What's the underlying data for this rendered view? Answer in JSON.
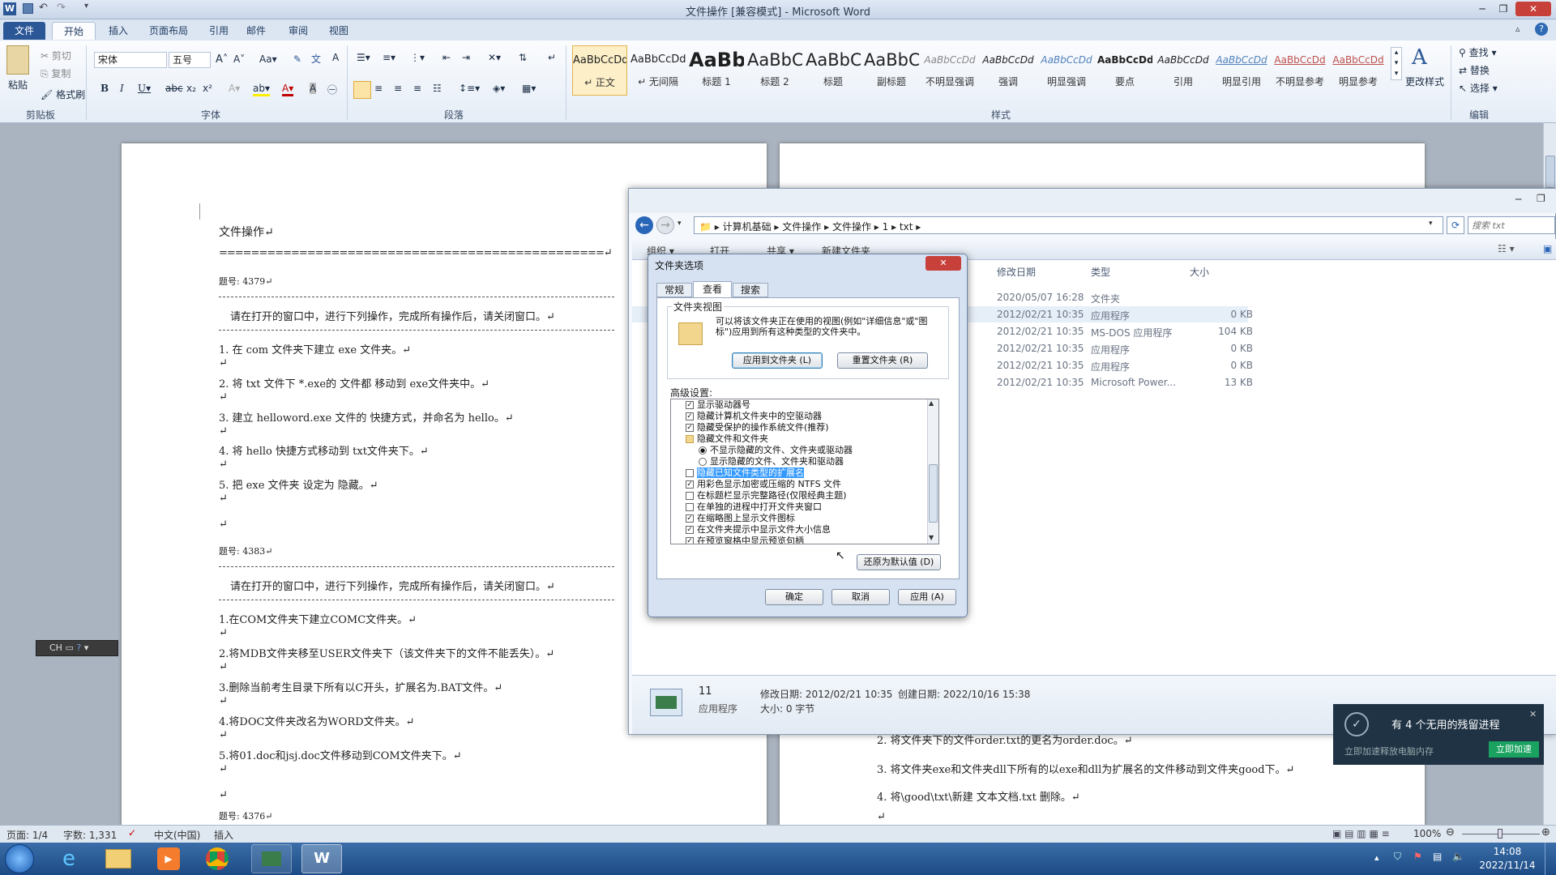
{
  "window": {
    "title": "文件操作 [兼容模式] - Microsoft Word"
  },
  "tabs": [
    "文件",
    "开始",
    "插入",
    "页面布局",
    "引用",
    "邮件",
    "审阅",
    "视图"
  ],
  "ribbon": {
    "clipboard": {
      "paste": "粘贴",
      "cut": "剪切",
      "copy": "复制",
      "format_painter": "格式刷",
      "label": "剪贴板"
    },
    "font": {
      "name": "宋体",
      "size": "五号",
      "label": "字体"
    },
    "paragraph": {
      "label": "段落"
    },
    "styles": {
      "label": "样式",
      "items": [
        {
          "preview": "AaBbCcDd",
          "name": "↵ 正文"
        },
        {
          "preview": "AaBbCcDd",
          "name": "↵ 无间隔"
        },
        {
          "preview": "AaBb",
          "name": "标题 1"
        },
        {
          "preview": "AaBbC",
          "name": "标题 2"
        },
        {
          "preview": "AaBbC",
          "name": "标题"
        },
        {
          "preview": "AaBbC",
          "name": "副标题"
        },
        {
          "preview": "AaBbCcDd",
          "name": "不明显强调"
        },
        {
          "preview": "AaBbCcDd",
          "name": "强调"
        },
        {
          "preview": "AaBbCcDd",
          "name": "明显强调"
        },
        {
          "preview": "AaBbCcDd",
          "name": "要点"
        },
        {
          "preview": "AaBbCcDd",
          "name": "引用"
        },
        {
          "preview": "AaBbCcDd",
          "name": "明显引用"
        },
        {
          "preview": "AaBbCcDd",
          "name": "不明显参考"
        },
        {
          "preview": "AaBbCcDd",
          "name": "明显参考"
        }
      ],
      "change_styles": "更改样式"
    },
    "editing": {
      "find": "查找",
      "replace": "替换",
      "select": "选择",
      "label": "编辑"
    }
  },
  "doc_left": {
    "heading": "文件操作↵",
    "equals": "================================================↵",
    "q1_id": "题号: 4379↵",
    "instr": "请在打开的窗口中，进行下列操作，完成所有操作后，请关闭窗口。↵",
    "q1_items": [
      "1. 在 com 文件夹下建立 exe 文件夹。↵",
      "2. 将 txt 文件下 *.exe的 文件都 移动到 exe文件夹中。↵",
      "3. 建立 helloword.exe 文件的 快捷方式，并命名为 hello。↵",
      "4. 将 hello 快捷方式移动到 txt文件夹下。↵",
      "5. 把 exe 文件夹 设定为 隐藏。↵"
    ],
    "q2_id": "题号: 4383↵",
    "q2_items": [
      "1.在COM文件夹下建立COMC文件夹。↵",
      "2.将MDB文件夹移至USER文件夹下（该文件夹下的文件不能丢失）。↵",
      "3.删除当前考生目录下所有以C开头，扩展名为.BAT文件。↵",
      "4.将DOC文件夹改名为WORD文件夹。↵",
      "5.将01.doc和jsj.doc文件移动到COM文件夹下。↵"
    ],
    "q3_id": "题号: 4376↵",
    "ret": "↵"
  },
  "doc_right": {
    "lines": [
      "2. 将文件夹下的文件order.txt的更名为order.doc。↵",
      "3. 将文件夹exe和文件夹dll下所有的以exe和dll为扩展名的文件移动到文件夹good下。↵",
      "4. 将\\good\\txt\\新建 文本文档.txt 删除。↵",
      "↵"
    ]
  },
  "explorer": {
    "breadcrumb": [
      "计算机基础",
      "文件操作",
      "文件操作",
      "1",
      "txt"
    ],
    "search_placeholder": "搜索 txt",
    "toolbar": [
      "组织 ▾",
      "打开",
      "共享 ▾",
      "新建文件夹"
    ],
    "columns": {
      "date": "修改日期",
      "type": "类型",
      "size": "大小"
    },
    "rows": [
      {
        "date": "2020/05/07 16:28",
        "type": "文件夹",
        "size": ""
      },
      {
        "date": "2012/02/21 10:35",
        "type": "应用程序",
        "size": "0 KB"
      },
      {
        "date": "2012/02/21 10:35",
        "type": "MS-DOS 应用程序",
        "size": "104 KB"
      },
      {
        "date": "2012/02/21 10:35",
        "type": "应用程序",
        "size": "0 KB"
      },
      {
        "date": "2012/02/21 10:35",
        "type": "应用程序",
        "size": "0 KB"
      },
      {
        "date": "2012/02/21 10:35",
        "type": "Microsoft Power...",
        "size": "13 KB"
      }
    ],
    "details": {
      "name": "11",
      "kind": "应用程序",
      "modified": "修改日期: 2012/02/21 10:35",
      "size": "大小: 0 字节",
      "created": "创建日期: 2022/10/16 15:38"
    }
  },
  "dialog": {
    "title": "文件夹选项",
    "tabs": [
      "常规",
      "查看",
      "搜索"
    ],
    "folder_views": {
      "legend": "文件夹视图",
      "desc": "可以将该文件夹正在使用的视图(例如\"详细信息\"或\"图标\")应用到所有这种类型的文件夹中。",
      "apply": "应用到文件夹 (L)",
      "reset": "重置文件夹 (R)"
    },
    "advanced_label": "高级设置:",
    "advanced": [
      {
        "kind": "check",
        "checked": true,
        "text": "显示驱动器号",
        "indent": 1
      },
      {
        "kind": "check",
        "checked": true,
        "text": "隐藏计算机文件夹中的空驱动器",
        "indent": 1
      },
      {
        "kind": "check",
        "checked": true,
        "text": "隐藏受保护的操作系统文件(推荐)",
        "indent": 1
      },
      {
        "kind": "folder",
        "checked": false,
        "text": "隐藏文件和文件夹",
        "indent": 1
      },
      {
        "kind": "radio",
        "checked": true,
        "text": "不显示隐藏的文件、文件夹或驱动器",
        "indent": 2
      },
      {
        "kind": "radio",
        "checked": false,
        "text": "显示隐藏的文件、文件夹和驱动器",
        "indent": 2
      },
      {
        "kind": "check",
        "checked": false,
        "text": "隐藏已知文件类型的扩展名",
        "indent": 1,
        "highlight": true
      },
      {
        "kind": "check",
        "checked": true,
        "text": "用彩色显示加密或压缩的 NTFS 文件",
        "indent": 1
      },
      {
        "kind": "check",
        "checked": false,
        "text": "在标题栏显示完整路径(仅限经典主题)",
        "indent": 1
      },
      {
        "kind": "check",
        "checked": false,
        "text": "在单独的进程中打开文件夹窗口",
        "indent": 1
      },
      {
        "kind": "check",
        "checked": true,
        "text": "在缩略图上显示文件图标",
        "indent": 1
      },
      {
        "kind": "check",
        "checked": true,
        "text": "在文件夹提示中显示文件大小信息",
        "indent": 1
      },
      {
        "kind": "check",
        "checked": true,
        "text": "在预览窗格中显示预览句柄",
        "indent": 1
      }
    ],
    "restore": "还原为默认值 (D)",
    "ok": "确定",
    "cancel": "取消",
    "apply": "应用 (A)"
  },
  "toast": {
    "text": "有 4 个无用的残留进程",
    "count": "4",
    "sub": "立即加速释放电脑内存",
    "button": "立即加速"
  },
  "ime": {
    "label": "CH"
  },
  "status": {
    "page": "页面: 1/4",
    "words": "字数: 1,331",
    "lang": "中文(中国)",
    "mode": "插入",
    "zoom": "100%"
  },
  "clock": {
    "time": "14:08",
    "date": "2022/11/14"
  }
}
